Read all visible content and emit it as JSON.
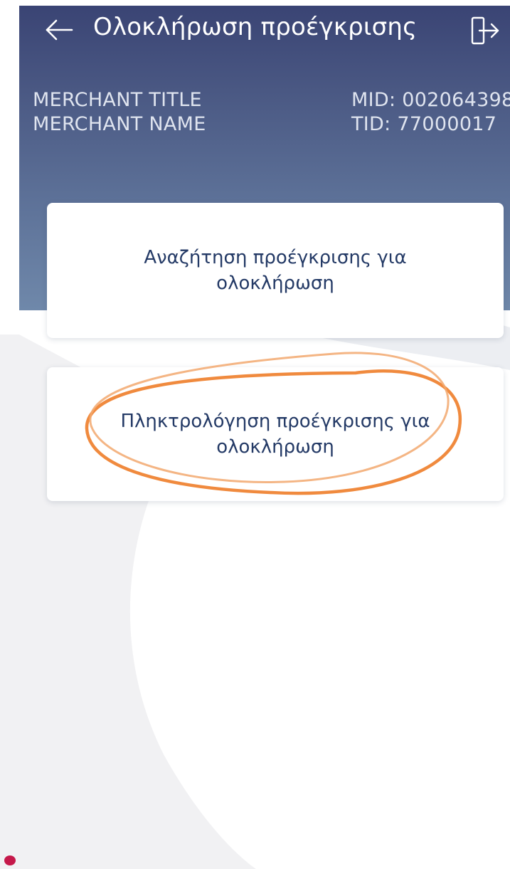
{
  "topbar": {
    "back_icon": "arrow-left-icon",
    "title": "Ολοκλήρωση προέγκρισης",
    "logout_icon": "logout-icon"
  },
  "merchant": {
    "title": "MERCHANT TITLE",
    "name": "MERCHANT NAME",
    "mid": "MID: 002064398",
    "tid": "TID: 77000017"
  },
  "options": [
    {
      "line1": "Αναζήτηση προέγκρισης για",
      "line2": "ολοκλήρωση"
    },
    {
      "line1": "Πληκτρολόγηση προέγκρισης για",
      "line2": "ολοκλήρωση"
    }
  ],
  "colors": {
    "header_top": "#3a4474",
    "header_bottom": "#6f88aa",
    "card_text": "#243a66",
    "annotation": "#f08a3e",
    "dot": "#c5184a"
  }
}
